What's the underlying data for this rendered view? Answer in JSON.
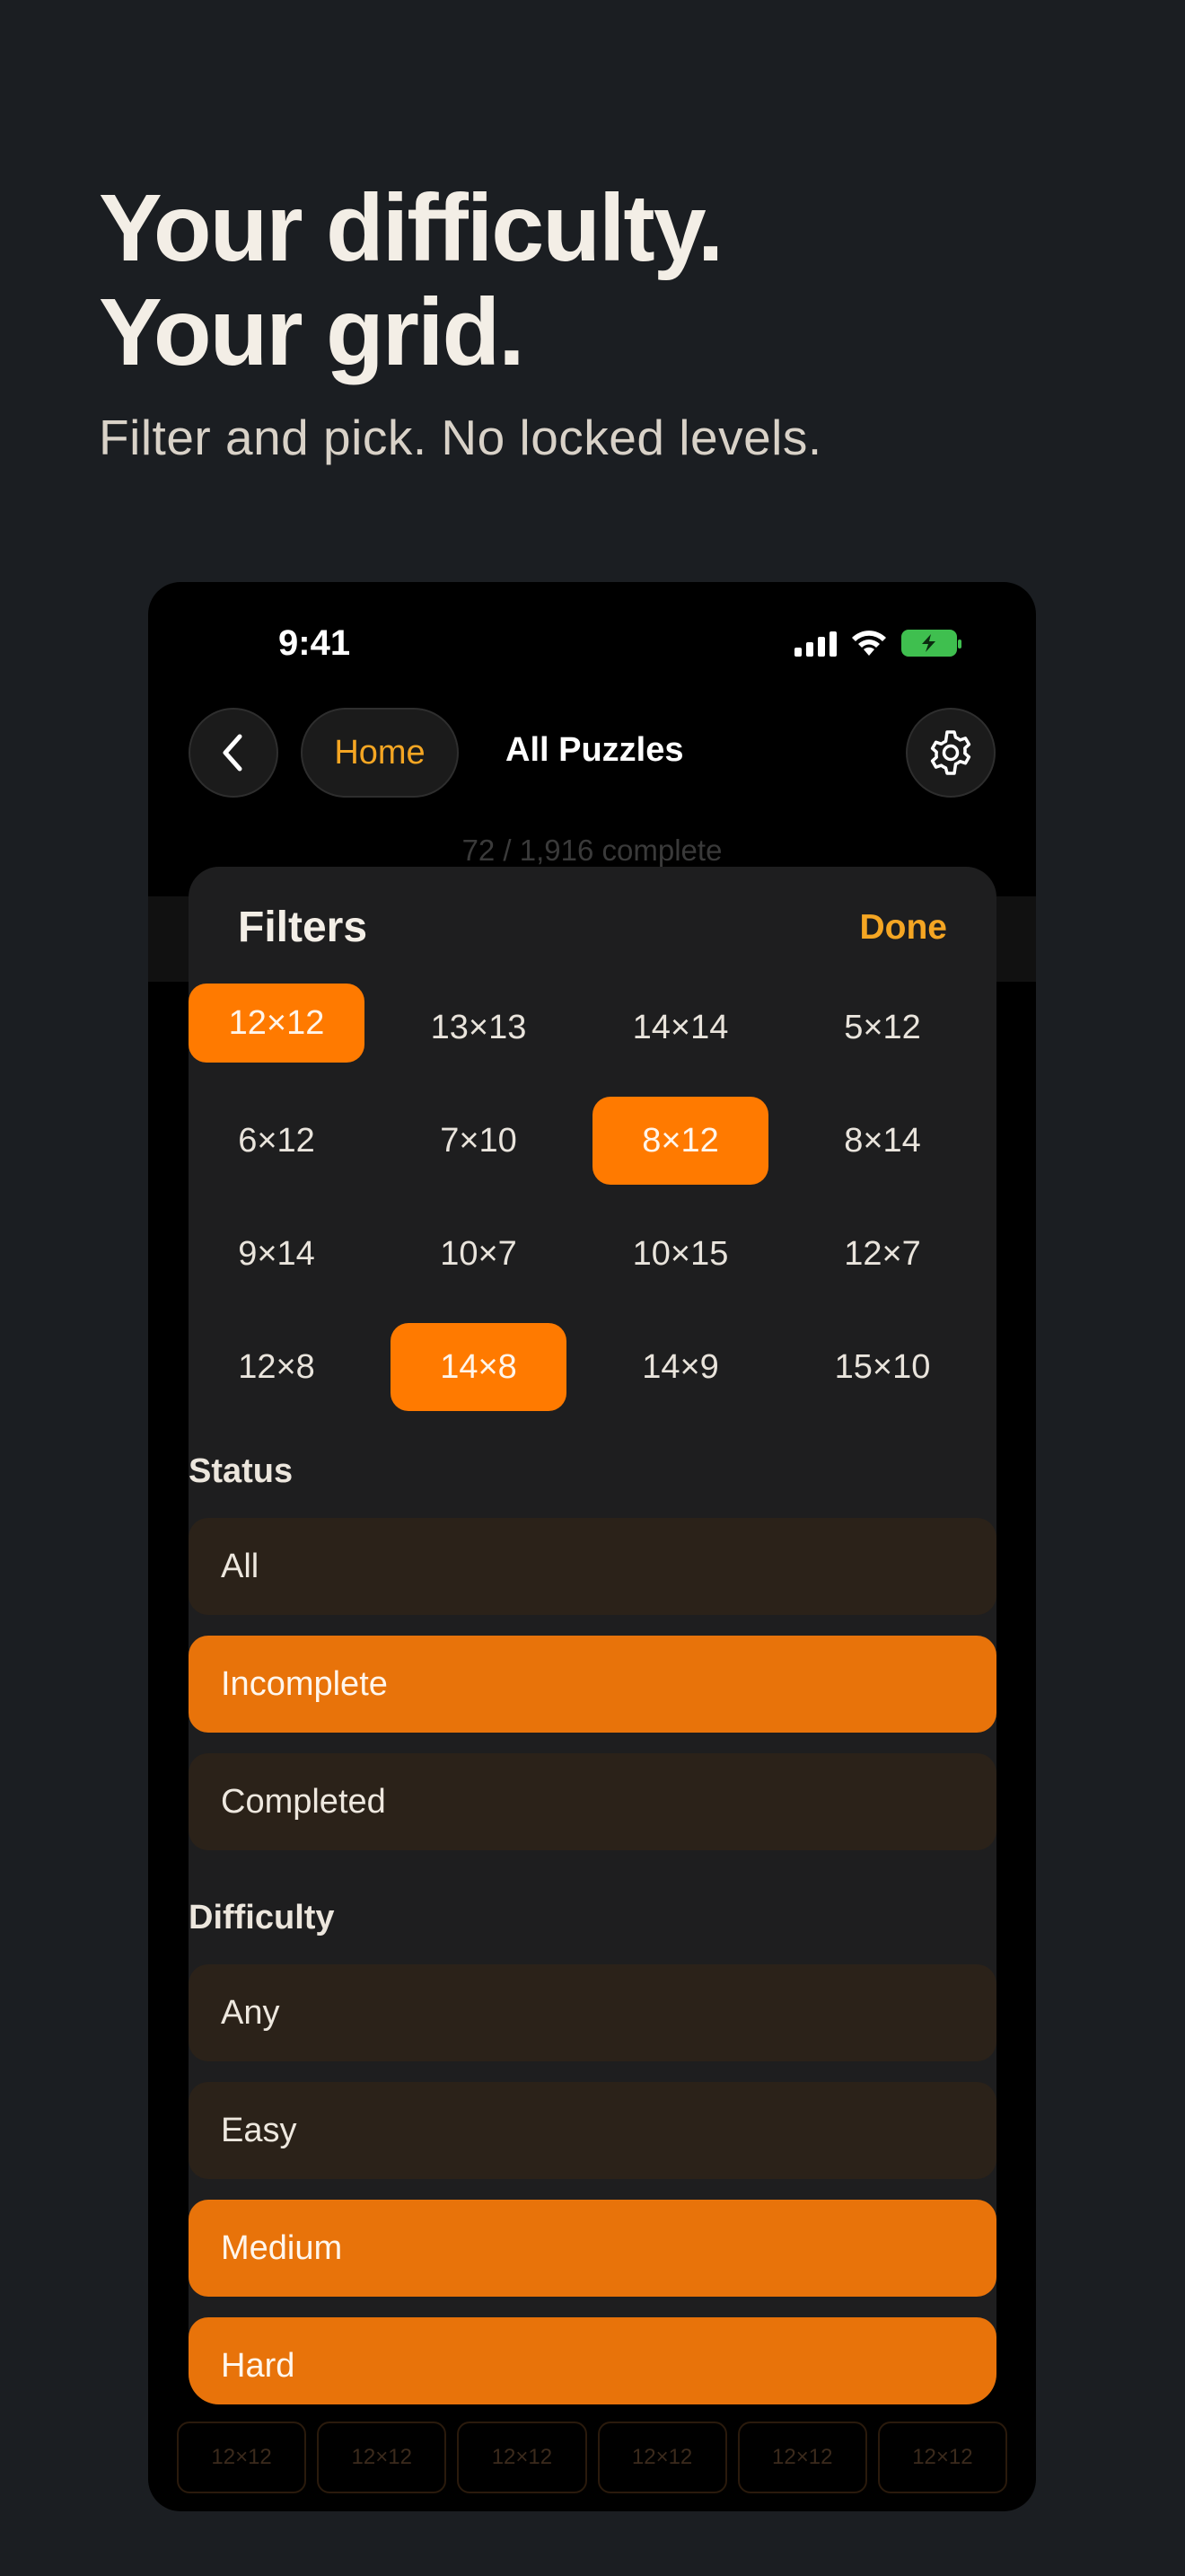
{
  "hero": {
    "title_line1": "Your difficulty.",
    "title_line2": "Your grid.",
    "subtitle": "Filter and pick. No locked levels."
  },
  "status_bar": {
    "time": "9:41",
    "battery_color": "#3fbf4f"
  },
  "nav": {
    "back_icon": "chevron-left-icon",
    "home_label": "Home",
    "title": "All Puzzles",
    "settings_icon": "gear-icon"
  },
  "progress": {
    "text": "72 / 1,916 complete"
  },
  "filters": {
    "title": "Filters",
    "done_label": "Done",
    "sizes": [
      {
        "label": "12×12",
        "selected": true
      },
      {
        "label": "13×13",
        "selected": false
      },
      {
        "label": "14×14",
        "selected": false
      },
      {
        "label": "5×12",
        "selected": false
      },
      {
        "label": "6×12",
        "selected": false
      },
      {
        "label": "7×10",
        "selected": false
      },
      {
        "label": "8×12",
        "selected": true
      },
      {
        "label": "8×14",
        "selected": false
      },
      {
        "label": "9×14",
        "selected": false
      },
      {
        "label": "10×7",
        "selected": false
      },
      {
        "label": "10×15",
        "selected": false
      },
      {
        "label": "12×7",
        "selected": false
      },
      {
        "label": "12×8",
        "selected": false
      },
      {
        "label": "14×8",
        "selected": true
      },
      {
        "label": "14×9",
        "selected": false
      },
      {
        "label": "15×10",
        "selected": false
      }
    ],
    "status": {
      "label": "Status",
      "options": [
        {
          "label": "All",
          "selected": false
        },
        {
          "label": "Incomplete",
          "selected": true
        },
        {
          "label": "Completed",
          "selected": false
        }
      ]
    },
    "difficulty": {
      "label": "Difficulty",
      "options": [
        {
          "label": "Any",
          "selected": false
        },
        {
          "label": "Easy",
          "selected": false
        },
        {
          "label": "Medium",
          "selected": true
        },
        {
          "label": "Hard",
          "selected": true
        }
      ]
    }
  },
  "background_grid": {
    "cells": [
      "12×12",
      "12×12",
      "12×12",
      "12×12",
      "12×12",
      "12×12"
    ]
  },
  "colors": {
    "accent": "#ff7a00",
    "accent_text": "#f5a623",
    "unselected_option": "#2b2219",
    "background": "#1b1e22"
  }
}
